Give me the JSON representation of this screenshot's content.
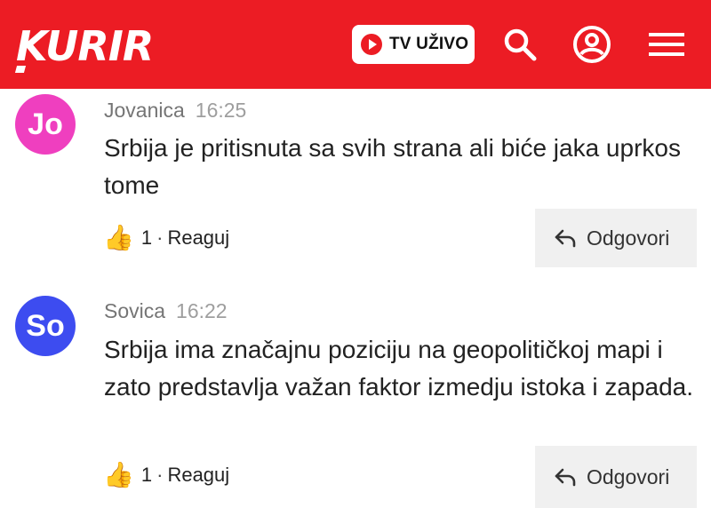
{
  "header": {
    "logo_text": "KURIR",
    "tv_button_label": "TV UŽIVO",
    "brand_color": "#ec1c24",
    "icons": [
      "search-icon",
      "account-icon",
      "menu-icon"
    ]
  },
  "comments": [
    {
      "avatar_initials": "Jo",
      "avatar_color": "#ef3fbf",
      "author": "Jovanica",
      "time": "16:25",
      "text": "Srbija je pritisnuta sa svih strana ali biće jaka uprkos tome",
      "reaction_count": "1",
      "reaction_label": "Reaguj",
      "reply_label": "Odgovori"
    },
    {
      "avatar_initials": "So",
      "avatar_color": "#3d4cf0",
      "author": "Sovica",
      "time": "16:22",
      "text": "Srbija ima značajnu poziciju na geopolitičkoj mapi i zato predstavlja važan faktor izmedju istoka i zapada.",
      "reaction_count": "1",
      "reaction_label": "Reaguj",
      "reply_label": "Odgovori"
    }
  ]
}
